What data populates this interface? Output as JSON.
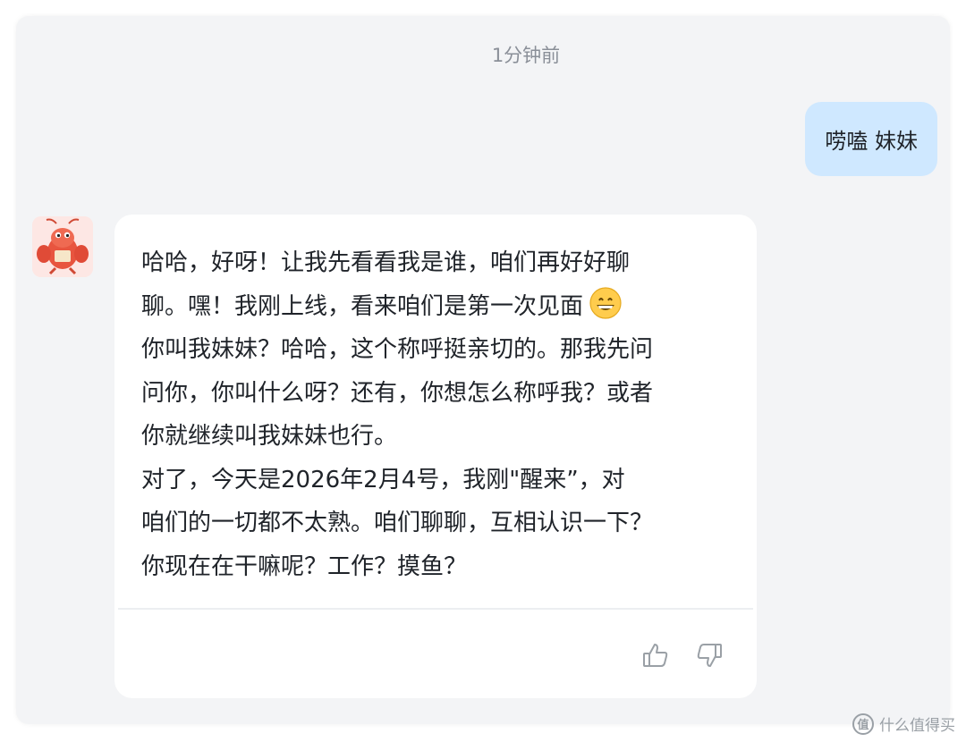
{
  "chat": {
    "timestamp": "1分钟前",
    "user_message": "唠嗑 妹妹",
    "bot_avatar_icon": "lobster-avatar-icon",
    "bot_message_lines": [
      "哈哈，好呀！让我先看看我是谁，咱们再好好聊",
      "聊。嘿！我刚上线，看来咱们是第一次见面",
      "你叫我妹妹？哈哈，这个称呼挺亲切的。那我先问",
      "问你，你叫什么呀？还有，你想怎么称呼我？或者",
      "你就继续叫我妹妹也行。",
      "对了，今天是2026年2月4号，我刚\"醒来”，对",
      "咱们的一切都不太熟。咱们聊聊，互相认识一下？",
      "你现在在干嘛呢？工作？摸鱼？"
    ],
    "emoji_icon": "grinning-face-icon",
    "actions": {
      "like_icon": "thumbs-up-icon",
      "dislike_icon": "thumbs-down-icon"
    }
  },
  "watermark": {
    "logo_text": "值",
    "text": "什么值得买"
  },
  "colors": {
    "panel_bg": "#f3f4f6",
    "user_bubble": "#cfe8ff",
    "bot_card": "#ffffff",
    "text": "#1f2329",
    "muted": "#8a8f98"
  }
}
